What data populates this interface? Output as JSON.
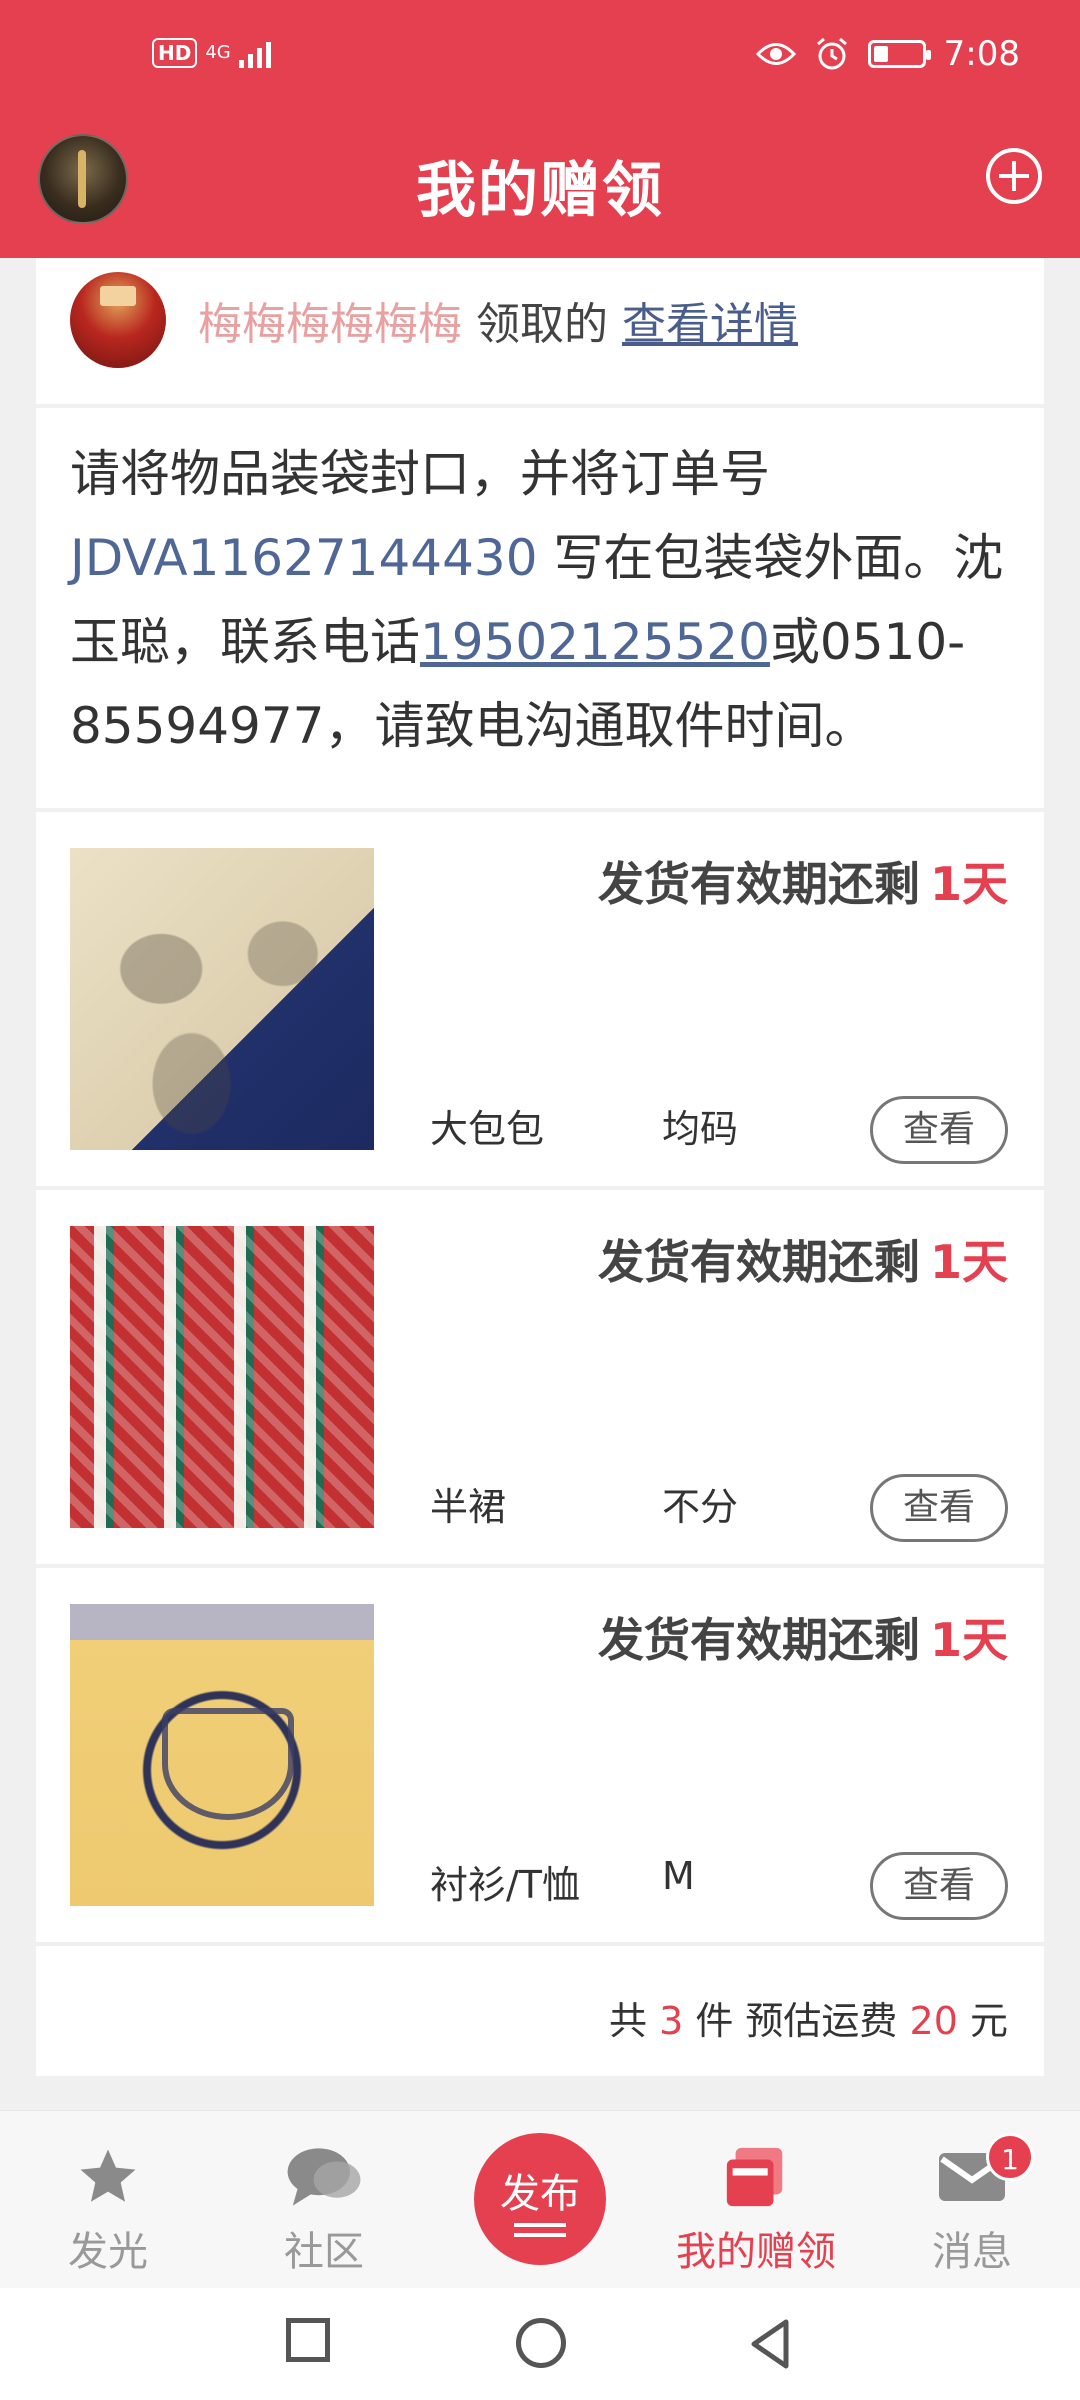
{
  "status_bar": {
    "hd": "HD",
    "network": "4G",
    "time": "7:08",
    "battery_level": 0.3
  },
  "header": {
    "title": "我的赠领"
  },
  "claimer": {
    "name": "梅梅梅梅梅梅",
    "action": "领取的",
    "detail_link": "查看详情"
  },
  "notice": {
    "prefix": "请将物品装袋封口，并将订单号 ",
    "order_no": "JDVA11627144430",
    "middle": " 写在包装袋外面。沈玉聪，联系电话",
    "phone": "19502125520",
    "suffix": "或0510-85594977，请致电沟通取件时间。"
  },
  "items": [
    {
      "expire_label": "发货有效期还剩",
      "days": "1天",
      "name": "大包包",
      "size": "均码",
      "view": "查看"
    },
    {
      "expire_label": "发货有效期还剩",
      "days": "1天",
      "name": "半裙",
      "size": "不分",
      "view": "查看"
    },
    {
      "expire_label": "发货有效期还剩",
      "days": "1天",
      "name": "衬衫/T恤",
      "size": "M",
      "view": "查看"
    }
  ],
  "summary": {
    "prefix": "共",
    "count": "3",
    "mid": "件 预估运费",
    "fee": "20",
    "unit": "元"
  },
  "tabs": [
    {
      "label": "发光",
      "icon": "star-icon"
    },
    {
      "label": "社区",
      "icon": "chat-bubble-icon"
    },
    {
      "label": "发布",
      "icon": "publish-icon"
    },
    {
      "label": "我的赠领",
      "icon": "gift-box-icon",
      "active": true
    },
    {
      "label": "消息",
      "icon": "mail-icon",
      "badge": "1"
    }
  ],
  "colors": {
    "brand": "#e5404f",
    "link": "#4f6796",
    "claimer_name": "#e8a0a0"
  }
}
